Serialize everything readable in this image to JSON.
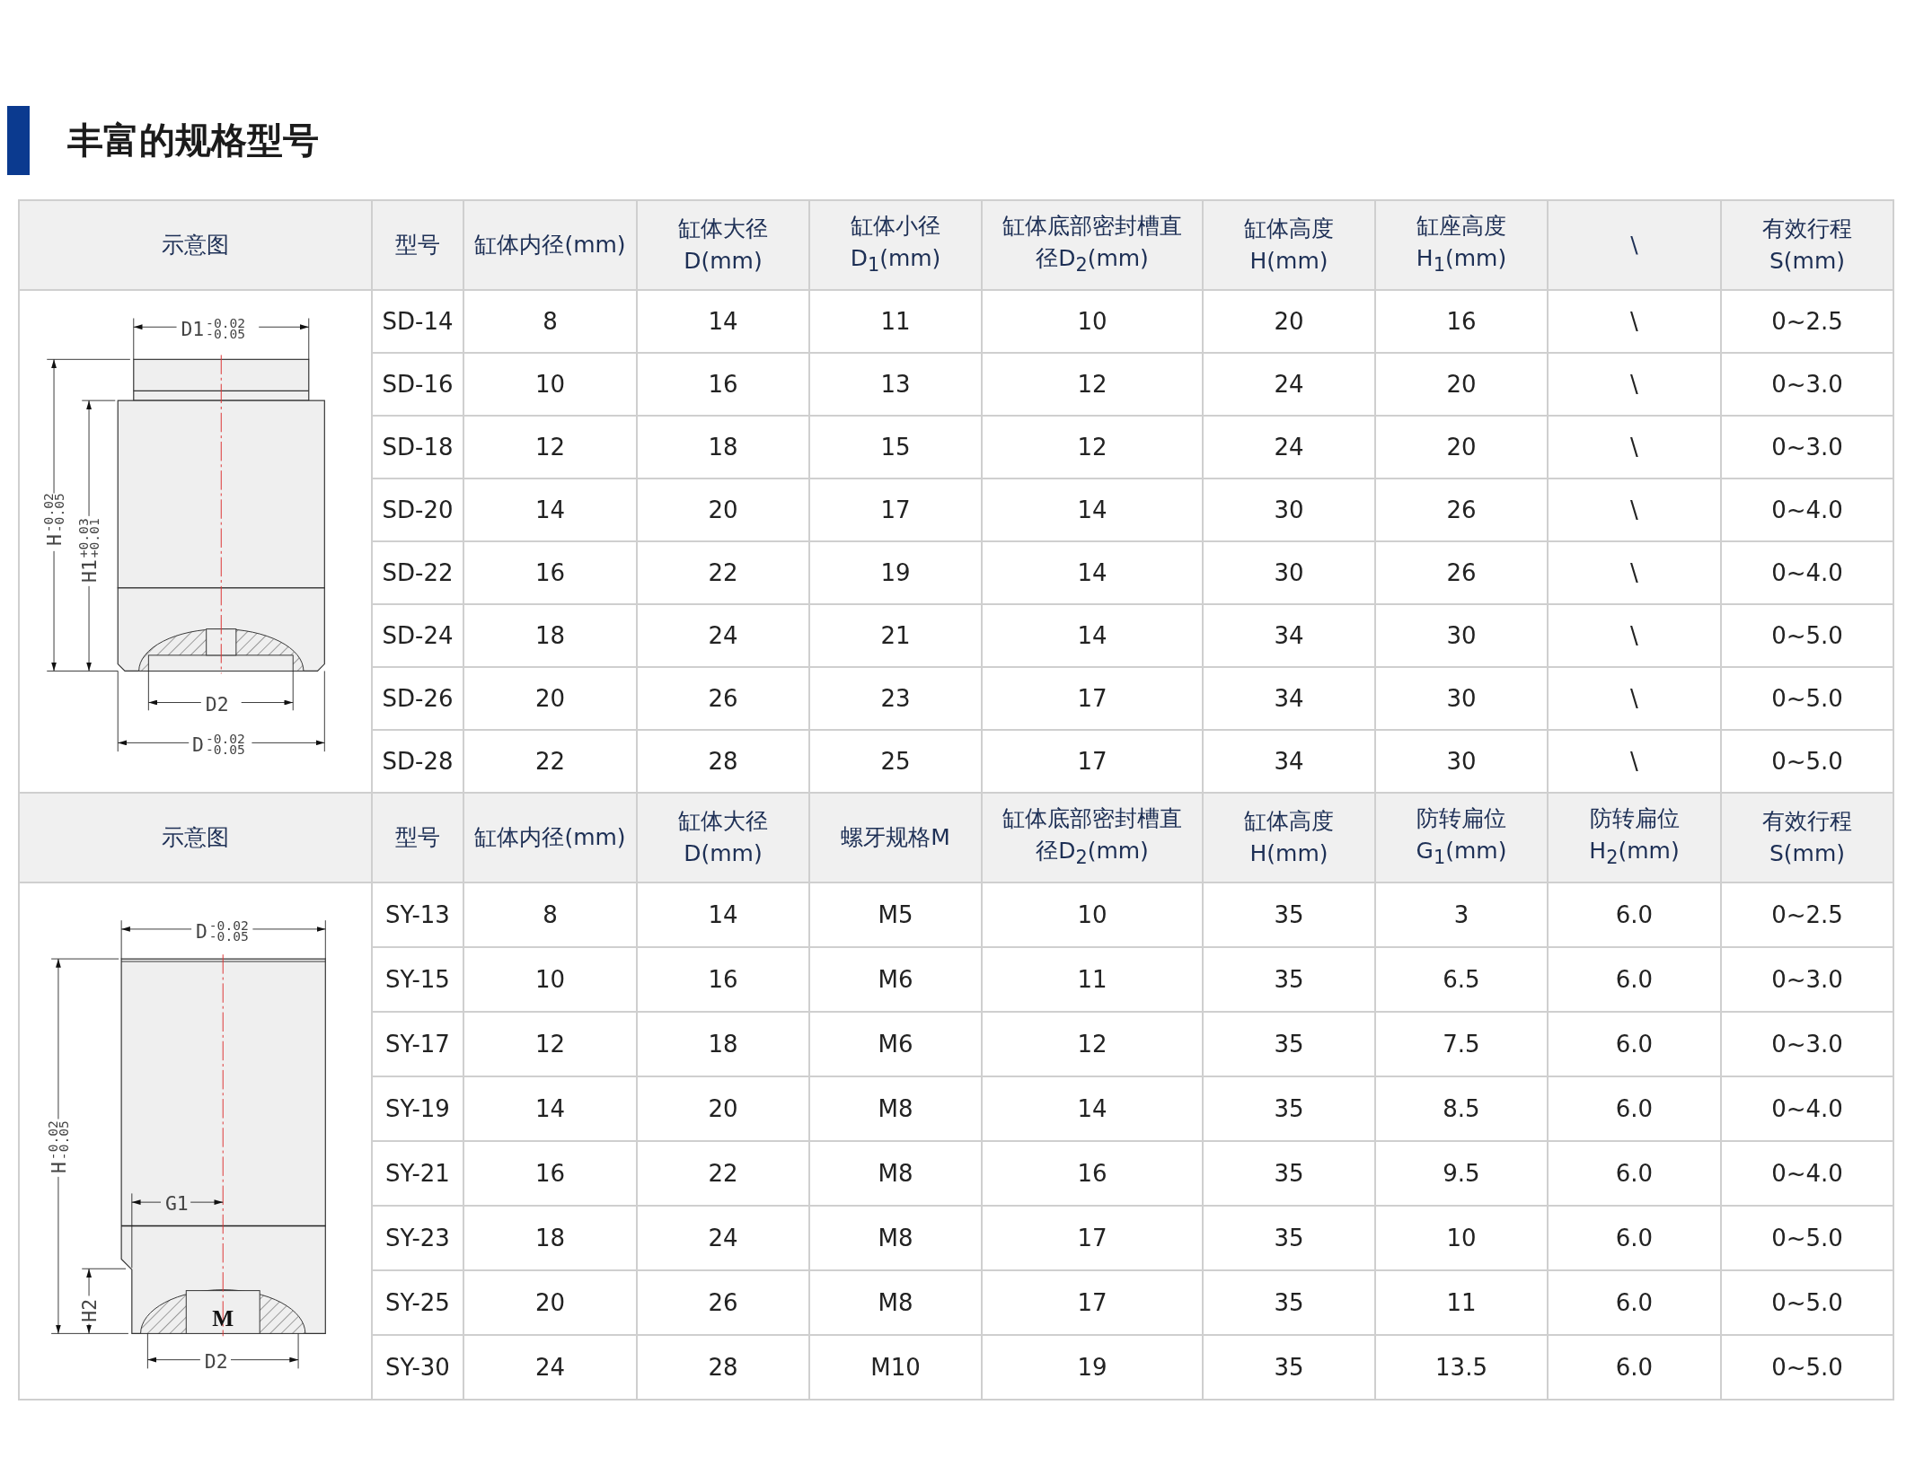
{
  "title": "丰富的规格型号",
  "sections": [
    {
      "drawing_header": "示意图",
      "columns": [
        {
          "lines": [
            "型号"
          ]
        },
        {
          "lines": [
            "缸体内径(mm)"
          ]
        },
        {
          "lines": [
            "缸体大径",
            "D(mm)"
          ]
        },
        {
          "lines": [
            "缸体小径",
            "D$_{1}$(mm)"
          ]
        },
        {
          "lines": [
            "缸体底部密封槽直",
            "径D$_{2}$(mm)"
          ]
        },
        {
          "lines": [
            "缸体高度",
            "H(mm)"
          ]
        },
        {
          "lines": [
            "缸座高度",
            "H$_{1}$(mm)"
          ]
        },
        {
          "lines": [
            "\\"
          ]
        },
        {
          "lines": [
            "有效行程",
            "S(mm)"
          ]
        }
      ],
      "drawing": {
        "kind": "stepped",
        "labels": [
          {
            "base": "D1",
            "upper": "-0.02",
            "lower": "-0.05"
          },
          {
            "base": "H",
            "upper": "-0.02",
            "lower": "-0.05"
          },
          {
            "base": "H1",
            "upper": "+0.03",
            "lower": "+0.01"
          },
          {
            "base": "D2"
          },
          {
            "base": "D",
            "upper": "-0.02",
            "lower": "-0.05"
          }
        ]
      },
      "rows": [
        [
          "SD-14",
          "8",
          "14",
          "11",
          "10",
          "20",
          "16",
          "\\",
          "0~2.5"
        ],
        [
          "SD-16",
          "10",
          "16",
          "13",
          "12",
          "24",
          "20",
          "\\",
          "0~3.0"
        ],
        [
          "SD-18",
          "12",
          "18",
          "15",
          "12",
          "24",
          "20",
          "\\",
          "0~3.0"
        ],
        [
          "SD-20",
          "14",
          "20",
          "17",
          "14",
          "30",
          "26",
          "\\",
          "0~4.0"
        ],
        [
          "SD-22",
          "16",
          "22",
          "19",
          "14",
          "30",
          "26",
          "\\",
          "0~4.0"
        ],
        [
          "SD-24",
          "18",
          "24",
          "21",
          "14",
          "34",
          "30",
          "\\",
          "0~5.0"
        ],
        [
          "SD-26",
          "20",
          "26",
          "23",
          "17",
          "34",
          "30",
          "\\",
          "0~5.0"
        ],
        [
          "SD-28",
          "22",
          "28",
          "25",
          "17",
          "34",
          "30",
          "\\",
          "0~5.0"
        ]
      ]
    },
    {
      "drawing_header": "示意图",
      "columns": [
        {
          "lines": [
            "型号"
          ]
        },
        {
          "lines": [
            "缸体内径(mm)"
          ]
        },
        {
          "lines": [
            "缸体大径",
            "D(mm)"
          ]
        },
        {
          "lines": [
            "螺牙规格M"
          ]
        },
        {
          "lines": [
            "缸体底部密封槽直",
            "径D$_{2}$(mm)"
          ]
        },
        {
          "lines": [
            "缸体高度",
            "H(mm)"
          ]
        },
        {
          "lines": [
            "防转扁位",
            "G$_{1}$(mm)"
          ]
        },
        {
          "lines": [
            "防转扁位",
            "H$_{2}$(mm)"
          ]
        },
        {
          "lines": [
            "有效行程",
            "S(mm)"
          ]
        }
      ],
      "drawing": {
        "kind": "threaded",
        "labels": [
          {
            "base": "D",
            "upper": "-0.02",
            "lower": "-0.05"
          },
          {
            "base": "H",
            "upper": "-0.02",
            "lower": "-0.05"
          },
          {
            "base": "G1"
          },
          {
            "base": "H2"
          },
          {
            "base": "M"
          },
          {
            "base": "D2"
          }
        ]
      },
      "rows": [
        [
          "SY-13",
          "8",
          "14",
          "M5",
          "10",
          "35",
          "3",
          "6.0",
          "0~2.5"
        ],
        [
          "SY-15",
          "10",
          "16",
          "M6",
          "11",
          "35",
          "6.5",
          "6.0",
          "0~3.0"
        ],
        [
          "SY-17",
          "12",
          "18",
          "M6",
          "12",
          "35",
          "7.5",
          "6.0",
          "0~3.0"
        ],
        [
          "SY-19",
          "14",
          "20",
          "M8",
          "14",
          "35",
          "8.5",
          "6.0",
          "0~4.0"
        ],
        [
          "SY-21",
          "16",
          "22",
          "M8",
          "16",
          "35",
          "9.5",
          "6.0",
          "0~4.0"
        ],
        [
          "SY-23",
          "18",
          "24",
          "M8",
          "17",
          "35",
          "10",
          "6.0",
          "0~5.0"
        ],
        [
          "SY-25",
          "20",
          "26",
          "M8",
          "17",
          "35",
          "11",
          "6.0",
          "0~5.0"
        ],
        [
          "SY-30",
          "24",
          "28",
          "M10",
          "19",
          "35",
          "13.5",
          "6.0",
          "0~5.0"
        ]
      ]
    }
  ]
}
